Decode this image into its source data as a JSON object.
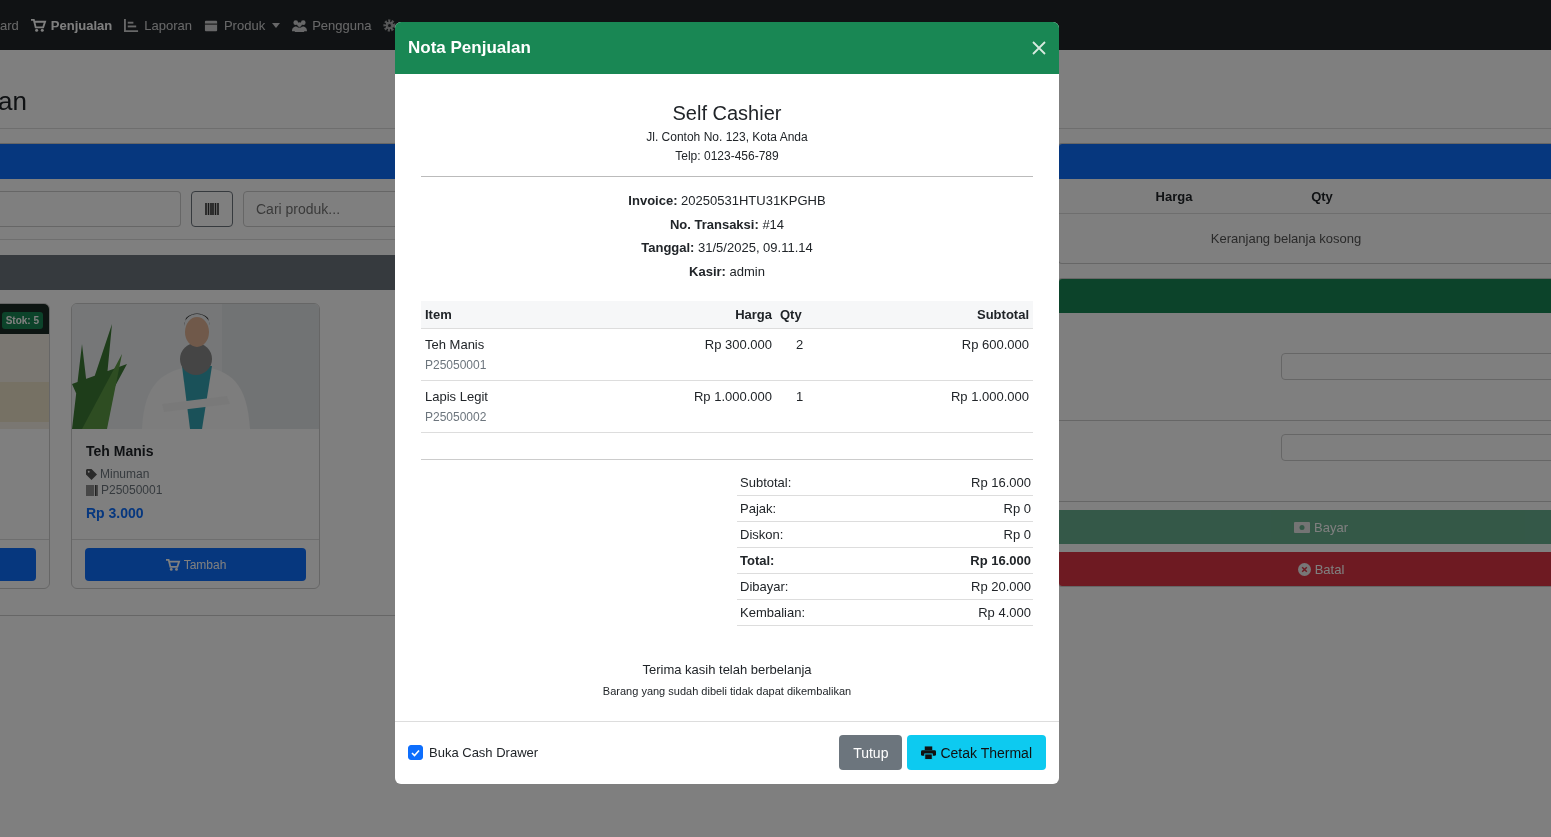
{
  "navbar": {
    "items": [
      {
        "label": "ard",
        "selected": false,
        "dropdown": false
      },
      {
        "label": "Penjualan",
        "selected": true,
        "dropdown": false
      },
      {
        "label": "Laporan",
        "selected": false,
        "dropdown": false
      },
      {
        "label": "Produk",
        "selected": false,
        "dropdown": true
      },
      {
        "label": "Pengguna",
        "selected": false,
        "dropdown": false
      }
    ]
  },
  "page": {
    "heading": "an"
  },
  "products": {
    "search_placeholder": "Cari produk...",
    "cards": [
      {
        "kind": "partial",
        "badge": "Stok: 5"
      },
      {
        "kind": "full",
        "name": "Teh Manis",
        "category": "Minuman",
        "code": "P25050001",
        "price": "Rp 3.000",
        "button": "Tambah"
      }
    ]
  },
  "cart": {
    "columns": [
      "Harga",
      "Qty"
    ],
    "empty_message": "Keranjang belanja kosong",
    "buttons": [
      {
        "label": "Bayar",
        "kind": "pay",
        "disabled": true
      },
      {
        "label": "Batal",
        "kind": "cancel",
        "disabled": false
      }
    ]
  },
  "modal": {
    "title": "Nota Penjualan",
    "store": {
      "name": "Self Cashier",
      "address": "Jl. Contoh No. 123, Kota Anda",
      "phone": "Telp: 0123-456-789"
    },
    "meta": [
      "**Invoice:** 20250531HTU31KPGHB",
      "**No. Transaksi:** #14",
      "**Tanggal:** 31/5/2025, 09.11.14",
      "**Kasir:** admin"
    ],
    "table": {
      "columns": [
        "Item",
        "Harga",
        "Qty",
        "Subtotal"
      ],
      "rows": [
        {
          "item": "Teh Manis",
          "code": "P25050001",
          "price": "Rp 300.000",
          "qty": "2",
          "subtotal": "Rp 600.000"
        },
        {
          "item": "Lapis Legit",
          "code": "P25050002",
          "price": "Rp 1.000.000",
          "qty": "1",
          "subtotal": "Rp 1.000.000"
        }
      ]
    },
    "summary": [
      {
        "label": "Subtotal:",
        "value": "Rp 16.000",
        "bold": false
      },
      {
        "label": "Pajak:",
        "value": "Rp 0",
        "bold": false
      },
      {
        "label": "Diskon:",
        "value": "Rp 0",
        "bold": false
      },
      {
        "label": "Total:",
        "value": "Rp 16.000",
        "bold": true
      },
      {
        "label": "Dibayar:",
        "value": "Rp 20.000",
        "bold": false
      },
      {
        "label": "Kembalian:",
        "value": "Rp 4.000",
        "bold": false
      }
    ],
    "footer_notes": [
      "Terima kasih telah berbelanja",
      "Barang yang sudah dibeli tidak dapat dikembalikan"
    ],
    "cash_drawer": {
      "label": "Buka Cash Drawer",
      "checked": true
    },
    "buttons": [
      {
        "label": "Tutup",
        "kind": "secondary"
      },
      {
        "label": "Cetak Thermal",
        "kind": "print"
      }
    ]
  }
}
